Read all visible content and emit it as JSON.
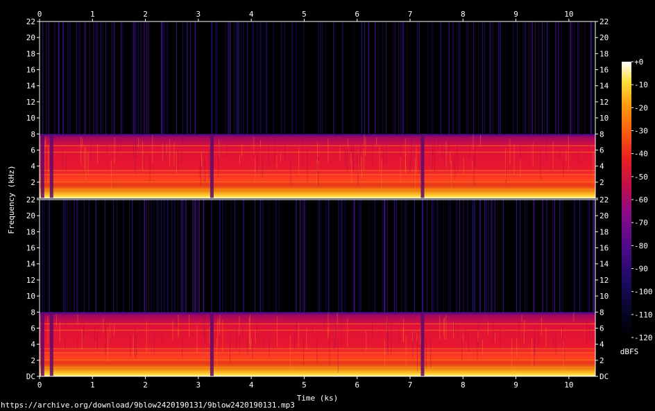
{
  "chart_data": {
    "type": "heatmap",
    "xlabel": "Time (ks)",
    "ylabel": "Frequency (kHz)",
    "colorbar_label": "dBFS",
    "x_ticks": [
      "0",
      "1",
      "2",
      "3",
      "4",
      "5",
      "6",
      "7",
      "8",
      "9",
      "10"
    ],
    "x_range": [
      0,
      10.5
    ],
    "y_ticks_left": [
      "DC",
      "2",
      "4",
      "6",
      "8",
      "10",
      "12",
      "14",
      "16",
      "18",
      "20",
      "22"
    ],
    "y_range_khz": [
      0,
      22
    ],
    "colorbar_ticks": [
      "+0",
      "-10",
      "-20",
      "-30",
      "-40",
      "-50",
      "-60",
      "-70",
      "-80",
      "-90",
      "-100",
      "-110",
      "-120"
    ],
    "colorbar_range_db": [
      -120,
      0
    ],
    "channels": 2,
    "energy_band_khz": [
      0,
      8
    ],
    "gap_times_ks": [
      0.05,
      0.22,
      3.25,
      7.23
    ]
  },
  "footer": {
    "url": "https://archive.org/download/9blow2420190131/9blow2420190131.mp3"
  }
}
